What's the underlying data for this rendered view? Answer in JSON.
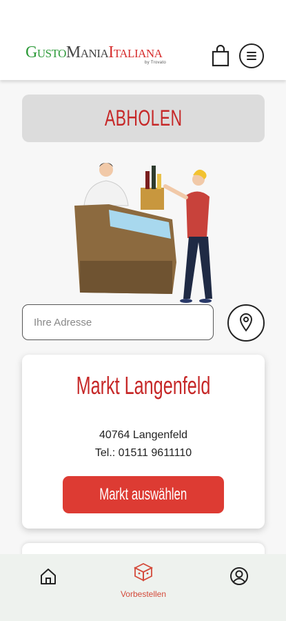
{
  "header": {
    "logo": {
      "part1": "Gusto",
      "part2": "Mania",
      "part3": "Italiana",
      "subtitle": "by Trovato"
    },
    "cart_icon": "shopping-bag-icon",
    "menu_icon": "hamburger-menu-icon"
  },
  "mode": {
    "title": "ABHOLEN"
  },
  "address": {
    "placeholder": "Ihre Adresse",
    "locate_icon": "location-pin-icon"
  },
  "stores": [
    {
      "name": "Markt Langenfeld",
      "zip_city": "40764 Langenfeld",
      "phone": "Tel.: 01511 9611110",
      "select_label": "Markt auswählen"
    }
  ],
  "bottom_nav": {
    "items": [
      {
        "icon": "home-icon",
        "label": ""
      },
      {
        "icon": "gift-box-icon",
        "label": "Vorbestellen",
        "active": true
      },
      {
        "icon": "user-profile-icon",
        "label": ""
      }
    ]
  },
  "colors": {
    "accent_red": "#c62828",
    "button_red": "#dd3b33",
    "logo_green": "#2e9b3a",
    "nav_active": "#d44a3a",
    "banner_gray": "#dcdcdc"
  }
}
